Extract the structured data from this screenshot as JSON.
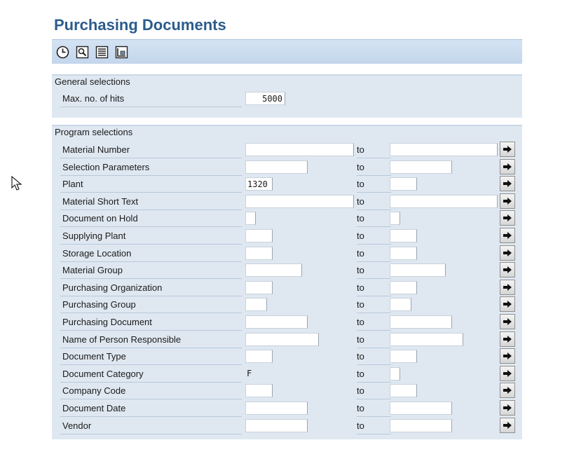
{
  "page": {
    "title": "Purchasing Documents"
  },
  "toolbar": {
    "buttons": [
      {
        "icon": "execute-clock-icon"
      },
      {
        "icon": "get-variant-icon"
      },
      {
        "icon": "list-icon"
      },
      {
        "icon": "dynamic-selection-icon"
      }
    ]
  },
  "general": {
    "title": "General selections",
    "max_hits_label": "Max. no. of hits",
    "max_hits_value": "5000"
  },
  "program": {
    "title": "Program selections",
    "to_label": "to",
    "rows": [
      {
        "label": "Material Number",
        "from": "",
        "to": ""
      },
      {
        "label": "Selection Parameters",
        "from": "",
        "to": ""
      },
      {
        "label": "Plant",
        "from": "1320",
        "to": ""
      },
      {
        "label": "Material Short Text",
        "from": "",
        "to": ""
      },
      {
        "label": "Document on Hold",
        "from": "",
        "to": ""
      },
      {
        "label": "Supplying Plant",
        "from": "",
        "to": ""
      },
      {
        "label": "Storage Location",
        "from": "",
        "to": ""
      },
      {
        "label": "Material Group",
        "from": "",
        "to": ""
      },
      {
        "label": "Purchasing Organization",
        "from": "",
        "to": ""
      },
      {
        "label": "Purchasing Group",
        "from": "",
        "to": ""
      },
      {
        "label": "Purchasing Document",
        "from": "",
        "to": ""
      },
      {
        "label": "Name of Person Responsible",
        "from": "",
        "to": ""
      },
      {
        "label": "Document Type",
        "from": "",
        "to": ""
      },
      {
        "label": "Document Category",
        "from": "F",
        "to": ""
      },
      {
        "label": "Company Code",
        "from": "",
        "to": ""
      },
      {
        "label": "Document Date",
        "from": "",
        "to": ""
      },
      {
        "label": "Vendor",
        "from": "",
        "to": ""
      }
    ]
  }
}
